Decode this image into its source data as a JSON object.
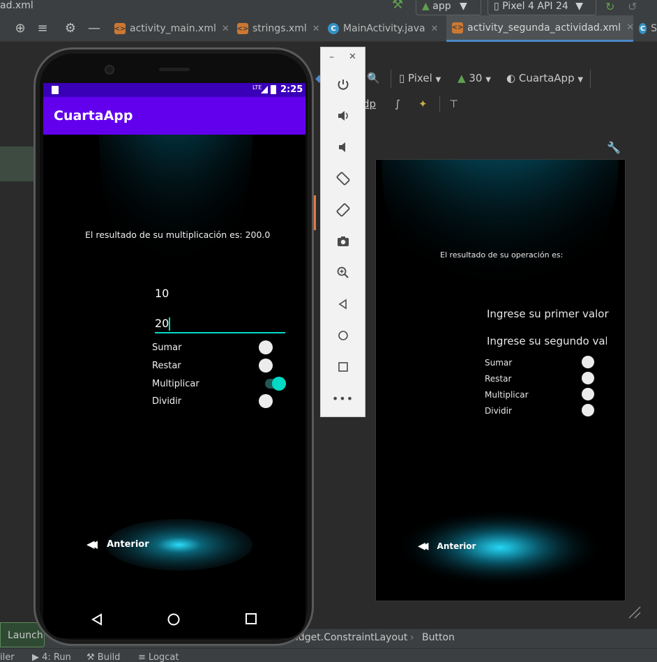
{
  "window": {
    "file_title": "ad.xml"
  },
  "toolbar": {
    "run_config": "app",
    "device": "Pixel 4 API 24"
  },
  "tabs": [
    {
      "label": "activity_main.xml",
      "type": "xml"
    },
    {
      "label": "strings.xml",
      "type": "xml"
    },
    {
      "label": "MainActivity.java",
      "type": "java"
    },
    {
      "label": "activity_segunda_actividad.xml",
      "type": "xml",
      "active": true
    },
    {
      "label": "S",
      "type": "java"
    }
  ],
  "design_toolbar": {
    "device": "Pixel",
    "api": "30",
    "theme": "CuartaApp",
    "dp": "dp"
  },
  "phone": {
    "status": {
      "lte": "LTE",
      "time": "2:25"
    },
    "app_title": "CuartaApp",
    "result_text": "El resultado de su multiplicación es: 200.0",
    "input1": "10",
    "input2": "20",
    "switches": [
      {
        "label": "Sumar",
        "on": false
      },
      {
        "label": "Restar",
        "on": false
      },
      {
        "label": "Multiplicar",
        "on": true
      },
      {
        "label": "Dividir",
        "on": false
      }
    ],
    "button_label": "Anterior"
  },
  "preview": {
    "result_text": "El resultado de su operación es:",
    "hint1": "Ingrese su primer valor",
    "hint2": "Ingrese su segundo valor",
    "switches": [
      "Sumar",
      "Restar",
      "Multiplicar",
      "Dividir"
    ],
    "button_label": "Anterior"
  },
  "breadcrumb": {
    "launch": "Launch",
    "item1": "idget.ConstraintLayout",
    "item2": "Button"
  },
  "bottom_tools": {
    "profiler": "iler",
    "run": "4: Run",
    "build": "Build",
    "logcat": "Logcat"
  },
  "colors": {
    "accent": "#03dac5",
    "primary": "#6200ee",
    "primary_dark": "#3700b3",
    "ide_bg": "#2b2b2b"
  }
}
